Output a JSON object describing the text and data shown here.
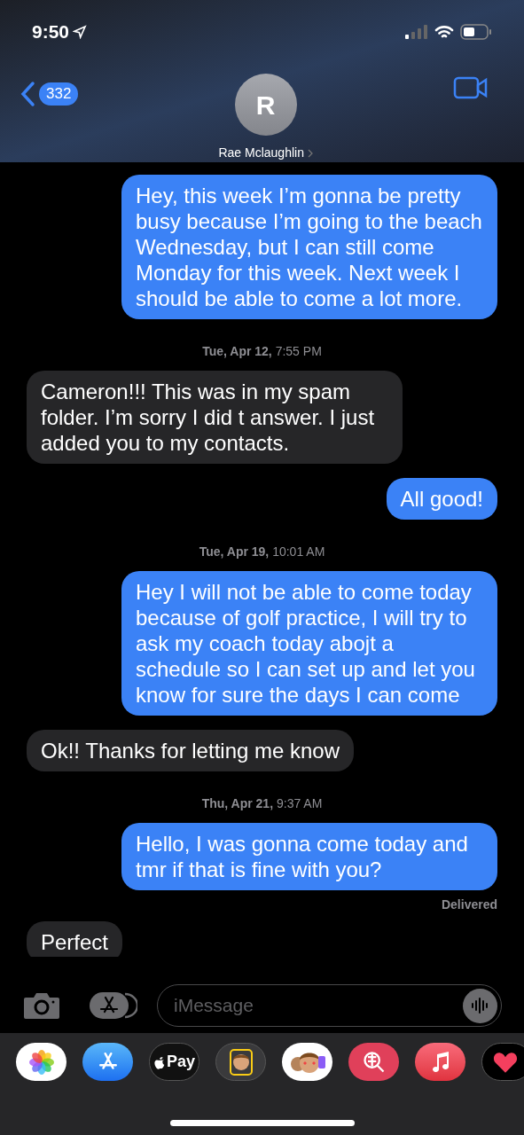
{
  "status_bar": {
    "time": "9:50"
  },
  "header": {
    "back_count": "332",
    "avatar_initial": "R",
    "contact_name": "Rae Mclaughlin"
  },
  "messages": [
    {
      "kind": "message",
      "sent": true,
      "text": "Hey, this week I’m gonna be pretty busy because I’m going to the beach Wednesday, but I can still come Monday for this week.  Next week I should be able to come a lot more."
    },
    {
      "kind": "timestamp",
      "text": "**Tue, Apr 12,** 7:55 PM"
    },
    {
      "kind": "message",
      "sent": false,
      "text": "Cameron!!! This was in my spam folder.  I’m sorry I did t answer.  I just added you to my contacts."
    },
    {
      "kind": "message",
      "sent": true,
      "text": "All good!"
    },
    {
      "kind": "timestamp",
      "text": "**Tue, Apr 19,** 10:01 AM"
    },
    {
      "kind": "message",
      "sent": true,
      "text": "Hey I will not be able to come today because of golf practice, I will try to ask my coach today abojt a schedule so I can set up and let you know for sure the days I can come"
    },
    {
      "kind": "message",
      "sent": false,
      "text": "Ok!! Thanks for letting me know"
    },
    {
      "kind": "timestamp",
      "text": "**Thu, Apr 21,** 9:37 AM"
    },
    {
      "kind": "message",
      "sent": true,
      "text": "Hello, I was gonna come today and tmr if that is fine with you?"
    },
    {
      "kind": "status",
      "text": "Delivered"
    },
    {
      "kind": "message",
      "sent": false,
      "text": "Perfect",
      "cut": true
    }
  ],
  "compose": {
    "placeholder": "iMessage"
  },
  "app_drawer": [
    {
      "kind": "photos"
    },
    {
      "kind": "appstore"
    },
    {
      "kind": "pay",
      "label": "Pay"
    },
    {
      "kind": "memoji"
    },
    {
      "kind": "stickers"
    },
    {
      "kind": "search"
    },
    {
      "kind": "music"
    },
    {
      "kind": "fitness"
    }
  ]
}
